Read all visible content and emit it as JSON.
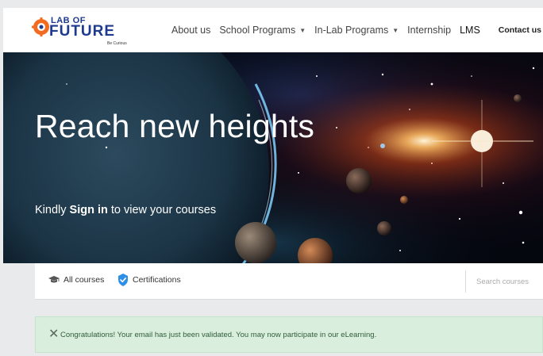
{
  "logo": {
    "top_text": "LAB OF",
    "main_text": "FUTURE",
    "tagline": "Be Curious"
  },
  "nav": {
    "items": [
      {
        "label": "About us",
        "has_dropdown": false
      },
      {
        "label": "School Programs",
        "has_dropdown": true
      },
      {
        "label": "In-Lab Programs",
        "has_dropdown": true
      },
      {
        "label": "Internship",
        "has_dropdown": false
      },
      {
        "label": "LMS",
        "has_dropdown": false
      }
    ],
    "contact_label": "Contact us"
  },
  "hero": {
    "title": "Reach new heights",
    "subtitle_prefix": "Kindly ",
    "subtitle_bold": "Sign in",
    "subtitle_suffix": " to view your courses"
  },
  "course_bar": {
    "all_courses_label": "All courses",
    "certifications_label": "Certifications",
    "search_placeholder": "Search courses"
  },
  "alert": {
    "close_symbol": "✕",
    "message": "Congratulations! Your email has just been validated. You may now participate in our eLearning."
  },
  "icons": {
    "logo_mark": "brain-gear-icon",
    "caret": "caret-down-icon",
    "all_courses": "graduation-cap-icon",
    "certifications": "verified-badge-icon",
    "close": "close-icon"
  },
  "colors": {
    "brand_blue": "#1d3a8f",
    "brand_orange": "#f26b21",
    "alert_bg": "#d9eedd",
    "alert_text": "#2f5d3a",
    "cert_badge": "#2d8fe6"
  }
}
